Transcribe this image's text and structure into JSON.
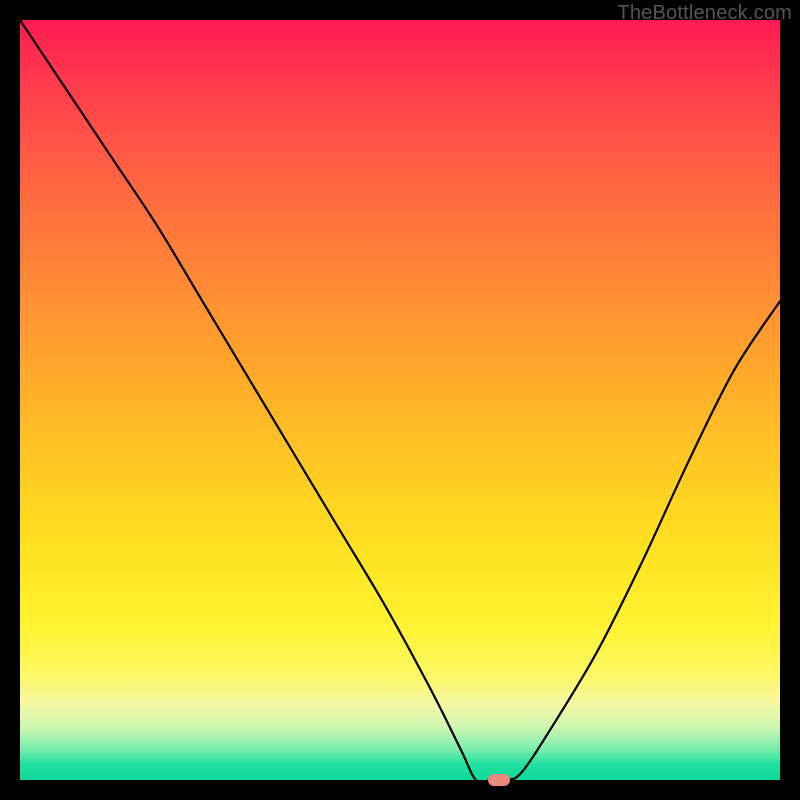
{
  "watermark": "TheBottleneck.com",
  "chart_data": {
    "type": "line",
    "title": "",
    "xlabel": "",
    "ylabel": "",
    "xlim": [
      0,
      100
    ],
    "ylim": [
      0,
      100
    ],
    "series": [
      {
        "name": "bottleneck-curve",
        "x": [
          0,
          6,
          12,
          18,
          24,
          30,
          36,
          42,
          48,
          54,
          58,
          60,
          62,
          64,
          66,
          70,
          76,
          82,
          88,
          94,
          100
        ],
        "y": [
          100,
          91,
          82,
          73,
          63,
          53,
          43,
          33,
          23,
          12,
          4,
          0,
          0,
          0,
          1,
          7,
          17,
          29,
          42,
          54,
          63
        ]
      }
    ],
    "marker": {
      "x": 63,
      "y": 0,
      "color": "#e9887d"
    },
    "gradient_stops": [
      {
        "pos": 0,
        "color": "#ff1a52"
      },
      {
        "pos": 50,
        "color": "#ffad2a"
      },
      {
        "pos": 85,
        "color": "#fdf863"
      },
      {
        "pos": 100,
        "color": "#10d99c"
      }
    ]
  }
}
